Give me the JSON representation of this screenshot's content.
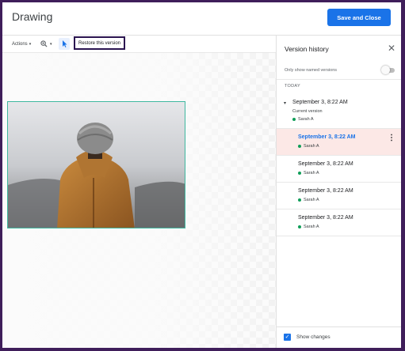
{
  "header": {
    "title": "Drawing",
    "save_label": "Save and Close"
  },
  "toolbar": {
    "actions_label": "Actions",
    "zoom_icon": "zoom-icon",
    "pointer_icon": "pointer-icon",
    "restore_label": "Restore this version"
  },
  "panel": {
    "title": "Version history",
    "close_icon": "close-icon",
    "named_only_label": "Only show named versions",
    "named_only_on": false,
    "section_label": "TODAY",
    "current_label": "Current version",
    "versions": [
      {
        "date": "September 3, 8:22 AM",
        "user": "Sarah A"
      },
      {
        "date": "September 3, 8:22 AM",
        "user": "Sarah A"
      },
      {
        "date": "September 3, 8:22 AM",
        "user": "Sarah A"
      },
      {
        "date": "September 3, 8:22 AM",
        "user": "Sarah A"
      },
      {
        "date": "September 3, 8:22 AM",
        "user": "Sarah A"
      }
    ],
    "show_changes_label": "Show changes",
    "show_changes_checked": true
  },
  "colors": {
    "accent": "#1a73e8",
    "selected_bg": "#fce8e6",
    "user_dot": "#0f9d58",
    "frame_border": "#3f1e5a"
  }
}
